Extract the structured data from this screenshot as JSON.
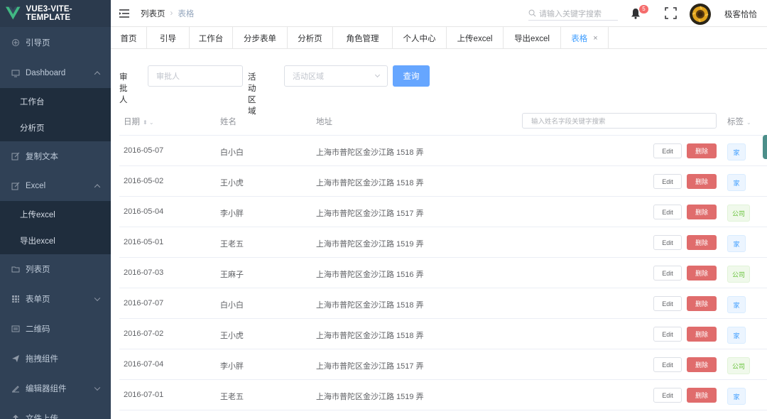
{
  "app": {
    "title": "VUE3-VITE-TEMPLATE"
  },
  "sidebar": {
    "items": [
      {
        "label": "引导页",
        "icon": "guide-icon"
      },
      {
        "label": "Dashboard",
        "icon": "dashboard-icon",
        "expanded": true,
        "children": [
          {
            "label": "工作台"
          },
          {
            "label": "分析页"
          }
        ]
      },
      {
        "label": "复制文本",
        "icon": "edit-icon"
      },
      {
        "label": "Excel",
        "icon": "edit-icon",
        "expanded": true,
        "children": [
          {
            "label": "上传excel"
          },
          {
            "label": "导出excel"
          }
        ]
      },
      {
        "label": "列表页",
        "icon": "folder-icon"
      },
      {
        "label": "表单页",
        "icon": "grid-icon",
        "expanded": false
      },
      {
        "label": "二维码",
        "icon": "qrcode-icon"
      },
      {
        "label": "拖拽组件",
        "icon": "send-icon"
      },
      {
        "label": "编辑器组件",
        "icon": "pen-icon",
        "expanded": false
      },
      {
        "label": "文件上传",
        "icon": "upload-icon"
      }
    ]
  },
  "header": {
    "breadcrumb": [
      "列表页",
      "表格"
    ],
    "search_placeholder": "请输入关键字搜索",
    "notification_count": "5",
    "username": "极客恰恰"
  },
  "tabs": [
    {
      "label": "首页"
    },
    {
      "label": "引导"
    },
    {
      "label": "工作台"
    },
    {
      "label": "分步表单"
    },
    {
      "label": "分析页"
    },
    {
      "label": "角色管理"
    },
    {
      "label": "个人中心"
    },
    {
      "label": "上传excel"
    },
    {
      "label": "导出excel"
    },
    {
      "label": "表格",
      "active": true,
      "closable": true
    }
  ],
  "filter": {
    "approver_label": "审批人",
    "approver_placeholder": "审批人",
    "region_label": "活动区域",
    "region_placeholder": "活动区域",
    "query_label": "查询"
  },
  "table": {
    "columns": {
      "date": "日期",
      "name": "姓名",
      "address": "地址",
      "tag": "标签"
    },
    "search_placeholder": "输入姓名字段关键字搜索",
    "edit_label": "Edit",
    "delete_label": "删除",
    "rows": [
      {
        "date": "2016-05-07",
        "name": "白小白",
        "address": "上海市普陀区金沙江路 1518 弄",
        "tag": "家",
        "tag_type": "home"
      },
      {
        "date": "2016-05-02",
        "name": "王小虎",
        "address": "上海市普陀区金沙江路 1518 弄",
        "tag": "家",
        "tag_type": "home"
      },
      {
        "date": "2016-05-04",
        "name": "李小胖",
        "address": "上海市普陀区金沙江路 1517 弄",
        "tag": "公司",
        "tag_type": "company"
      },
      {
        "date": "2016-05-01",
        "name": "王老五",
        "address": "上海市普陀区金沙江路 1519 弄",
        "tag": "家",
        "tag_type": "home"
      },
      {
        "date": "2016-07-03",
        "name": "王麻子",
        "address": "上海市普陀区金沙江路 1516 弄",
        "tag": "公司",
        "tag_type": "company"
      },
      {
        "date": "2016-07-07",
        "name": "白小白",
        "address": "上海市普陀区金沙江路 1518 弄",
        "tag": "家",
        "tag_type": "home"
      },
      {
        "date": "2016-07-02",
        "name": "王小虎",
        "address": "上海市普陀区金沙江路 1518 弄",
        "tag": "家",
        "tag_type": "home"
      },
      {
        "date": "2016-07-04",
        "name": "李小胖",
        "address": "上海市普陀区金沙江路 1517 弄",
        "tag": "公司",
        "tag_type": "company"
      },
      {
        "date": "2016-07-01",
        "name": "王老五",
        "address": "上海市普陀区金沙江路 1519 弄",
        "tag": "家",
        "tag_type": "home"
      }
    ]
  },
  "colors": {
    "sidebar_bg": "#304156",
    "submenu_bg": "#1f2d3d",
    "primary": "#409eff",
    "danger": "#e06c6c",
    "success": "#67c23a",
    "logo_green": "#41b883"
  }
}
